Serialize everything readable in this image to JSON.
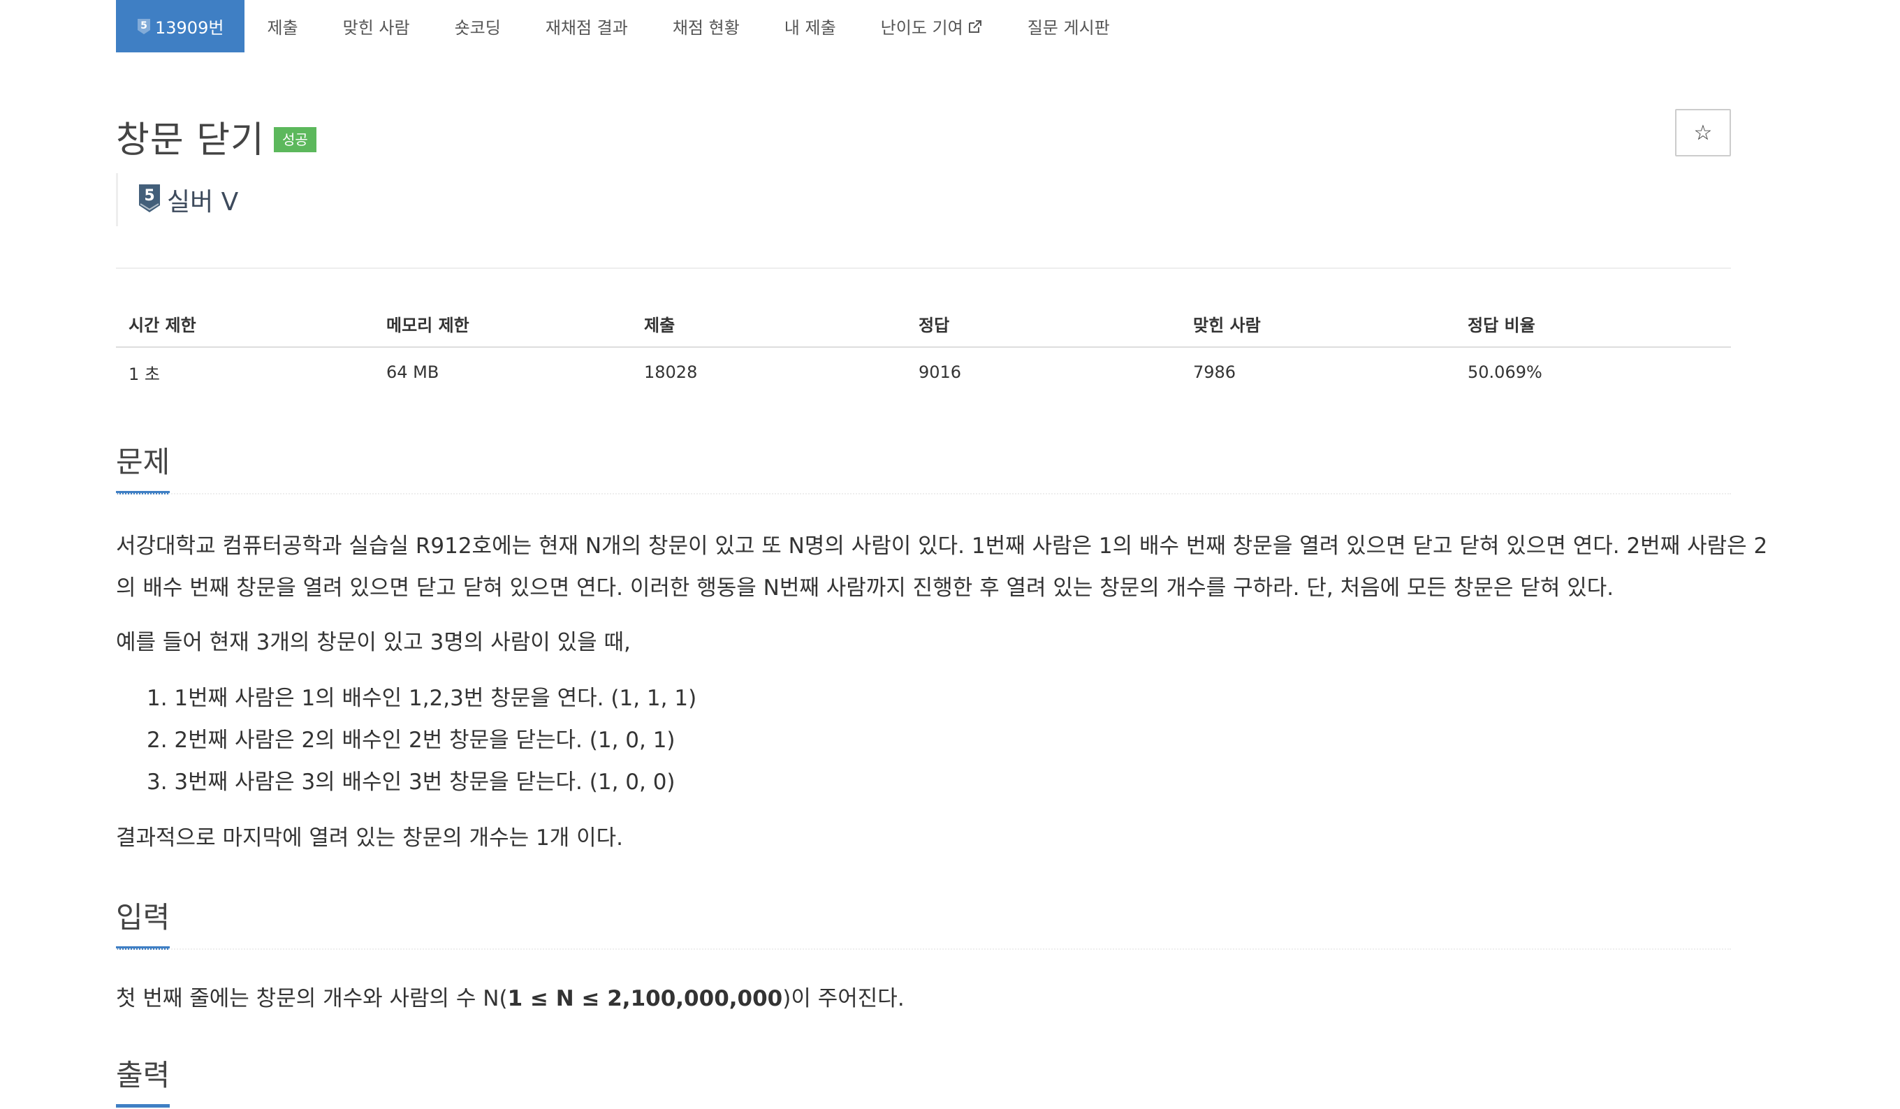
{
  "nav": {
    "problem_number": "13909번",
    "items": [
      "제출",
      "맞힌 사람",
      "숏코딩",
      "재채점 결과",
      "채점 현황",
      "내 제출",
      "난이도 기여",
      "질문 게시판"
    ]
  },
  "problem": {
    "title": "창문 닫기",
    "result_badge": "성공",
    "tier": "실버 V",
    "tier_level": "5",
    "star_icon": "☆"
  },
  "stats": {
    "headers": [
      "시간 제한",
      "메모리 제한",
      "제출",
      "정답",
      "맞힌 사람",
      "정답 비율"
    ],
    "values": [
      "1 초",
      "64 MB",
      "18028",
      "9016",
      "7986",
      "50.069%"
    ]
  },
  "sections": {
    "problem_title": "문제",
    "problem_line1": "서강대학교 컴퓨터공학과 실습실 R912호에는 현재 N개의 창문이 있고 또 N명의 사람이 있다. 1번째 사람은 1의 배수 번째 창문을 열려 있으면 닫고 닫혀 있으면 연다.  2번째 사람은 2",
    "problem_line2": "의 배수 번째 창문을 열려 있으면 닫고 닫혀 있으면 연다. 이러한 행동을 N번째 사람까지 진행한 후 열려 있는 창문의 개수를 구하라. 단, 처음에 모든 창문은 닫혀 있다.",
    "example_intro": "예를 들어 현재 3개의 창문이 있고 3명의 사람이 있을 때,",
    "steps": [
      "1. 1번째 사람은 1의 배수인 1,2,3번 창문을 연다. (1, 1, 1)",
      "2. 2번째 사람은 2의 배수인 2번 창문을 닫는다. (1, 0, 1)",
      "3. 3번째 사람은 3의 배수인 3번 창문을 닫는다. (1, 0, 0)"
    ],
    "conclusion": "결과적으로 마지막에 열려 있는 창문의 개수는 1개 이다.",
    "input_title": "입력",
    "input_prefix": "첫 번째 줄에는 창문의 개수와 사람의 수 N(",
    "input_bold": "1 ≤ N ≤ 2,100,000,000",
    "input_suffix": ")이 주어진다.",
    "output_title": "출력"
  },
  "colors": {
    "accent": "#3f7fc4",
    "success": "#5cb85c",
    "tier_silver": "#435f7a"
  }
}
